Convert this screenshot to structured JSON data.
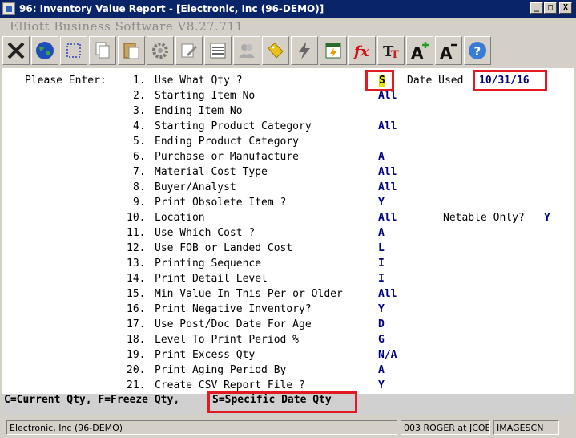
{
  "window": {
    "title": "96: Inventory Value Report - [Electronic, Inc (96-DEMO)]",
    "minimize": "_",
    "maximize": "□",
    "close": "X"
  },
  "app": {
    "name": "Elliott Business Software V8.27.711"
  },
  "toolbar": [
    "exit-icon",
    "globe-icon",
    "select-icon",
    "copy-icon",
    "paste-icon",
    "settings-icon",
    "edit-icon",
    "list-icon",
    "users-icon",
    "tag-icon",
    "lightning-icon",
    "calendar-icon",
    "function-icon",
    "text-style-icon",
    "font-larger-icon",
    "font-smaller-icon",
    "help-icon"
  ],
  "form": {
    "prompt": "Please Enter:",
    "fields": [
      {
        "num": "1.",
        "label": "Use What Qty ?",
        "value": "S"
      },
      {
        "num": "2.",
        "label": "Starting Item No",
        "value": "All"
      },
      {
        "num": "3.",
        "label": "Ending Item No",
        "value": ""
      },
      {
        "num": "4.",
        "label": "Starting Product Category",
        "value": "All"
      },
      {
        "num": "5.",
        "label": "Ending Product Category",
        "value": ""
      },
      {
        "num": "6.",
        "label": "Purchase or Manufacture",
        "value": "A"
      },
      {
        "num": "7.",
        "label": "Material Cost Type",
        "value": "All"
      },
      {
        "num": "8.",
        "label": "Buyer/Analyst",
        "value": "All"
      },
      {
        "num": "9.",
        "label": "Print Obsolete Item ?",
        "value": "Y"
      },
      {
        "num": "10.",
        "label": "Location",
        "value": "All"
      },
      {
        "num": "11.",
        "label": "Use Which Cost ?",
        "value": "A"
      },
      {
        "num": "12.",
        "label": "Use FOB or Landed Cost",
        "value": "L"
      },
      {
        "num": "13.",
        "label": "Printing Sequence",
        "value": "I"
      },
      {
        "num": "14.",
        "label": "Print Detail Level",
        "value": "I"
      },
      {
        "num": "15.",
        "label": "Min Value In This Per or Older",
        "value": "All"
      },
      {
        "num": "16.",
        "label": "Print Negative Inventory?",
        "value": "Y"
      },
      {
        "num": "17.",
        "label": "Use Post/Doc Date For Age",
        "value": "D"
      },
      {
        "num": "18.",
        "label": "Level To Print Period %",
        "value": "G"
      },
      {
        "num": "19.",
        "label": "Print Excess-Qty",
        "value": "N/A"
      },
      {
        "num": "20.",
        "label": "Print Aging Period By",
        "value": "A"
      },
      {
        "num": "21.",
        "label": "Create CSV Report File ?",
        "value": "Y"
      }
    ],
    "date_used_label": "Date Used",
    "date_used_value": "10/31/16",
    "netable_label": "Netable Only?",
    "netable_value": "Y"
  },
  "hint": {
    "part1": "C=Current Qty, F=Freeze Qty,",
    "part2": "S=Specific Date Qty"
  },
  "status": {
    "company": "Electronic, Inc (96-DEMO)",
    "user": "003 ROGER at JCOB",
    "scan": "IMAGESCN"
  },
  "colors": {
    "title_bar": "#0a246a",
    "value_text": "#000080",
    "highlight_box": "#e21b22",
    "cursor": "#e8e000"
  }
}
